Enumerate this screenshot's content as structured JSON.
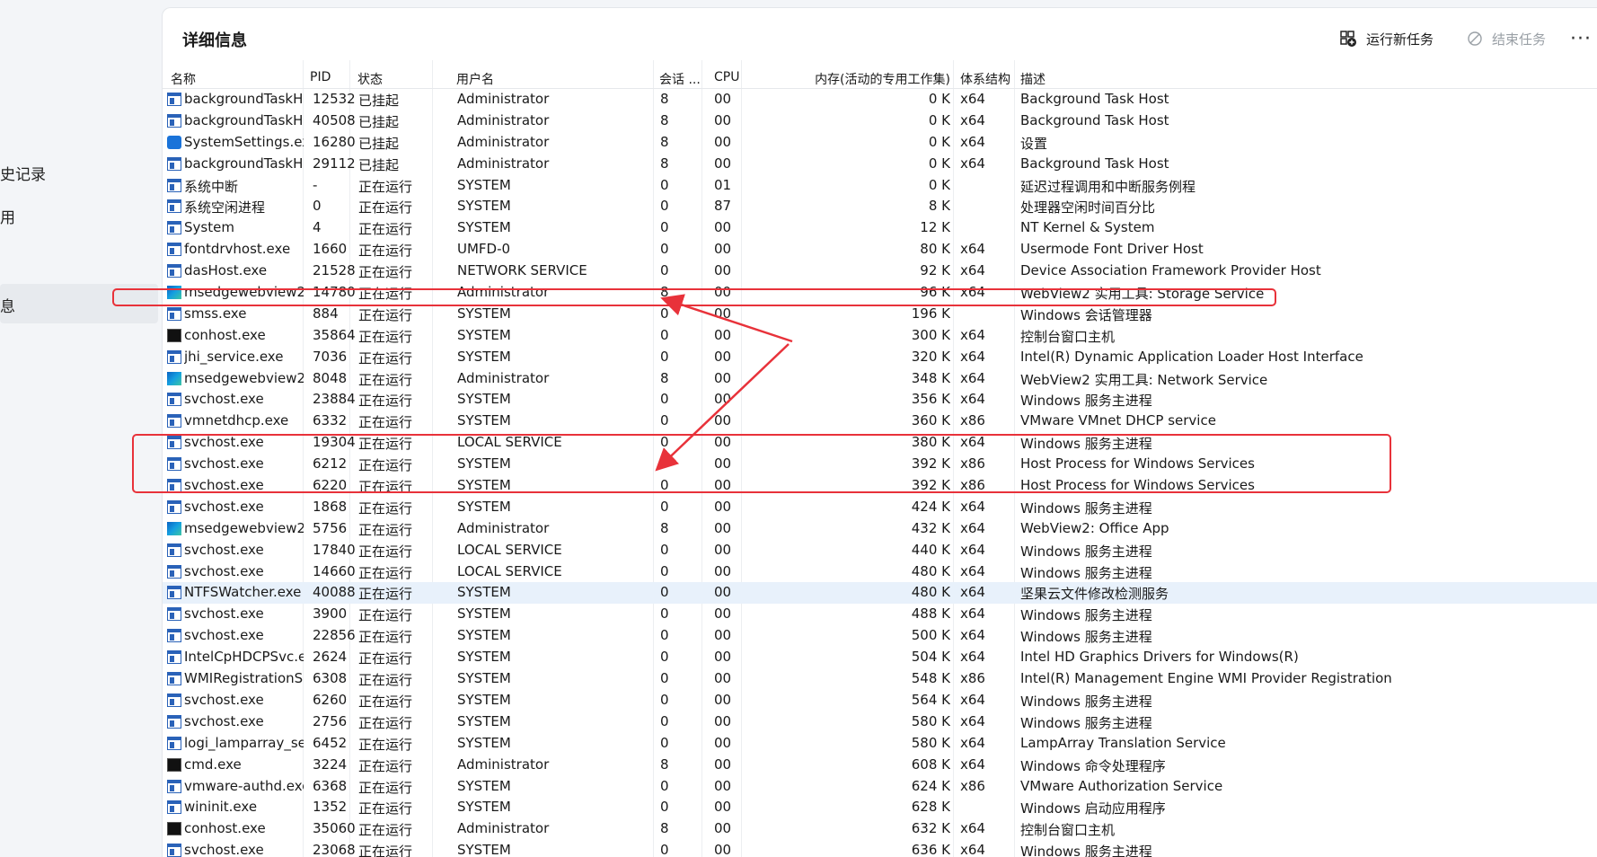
{
  "sidebar": {
    "items": [
      {
        "label": "史记录"
      },
      {
        "label": "用"
      },
      {
        "label": "息"
      }
    ]
  },
  "header": {
    "title": "详细信息",
    "run_new_task": "运行新任务",
    "end_task": "结束任务",
    "more": "···"
  },
  "columns": {
    "name": "名称",
    "pid": "PID",
    "status": "状态",
    "user": "用户名",
    "session": "会话 ...",
    "cpu": "CPU",
    "memory": "内存(活动的专用工作集)",
    "arch": "体系结构",
    "desc": "描述"
  },
  "rows": [
    {
      "icon": "window-icon",
      "name": "backgroundTaskH...",
      "pid": "12532",
      "status": "已挂起",
      "user": "Administrator",
      "session": "8",
      "cpu": "00",
      "mem": "0 K",
      "arch": "x64",
      "desc": "Background Task Host"
    },
    {
      "icon": "window-icon",
      "name": "backgroundTaskH...",
      "pid": "40508",
      "status": "已挂起",
      "user": "Administrator",
      "session": "8",
      "cpu": "00",
      "mem": "0 K",
      "arch": "x64",
      "desc": "Background Task Host"
    },
    {
      "icon": "gear-icon",
      "name": "SystemSettings.exe",
      "pid": "16280",
      "status": "已挂起",
      "user": "Administrator",
      "session": "8",
      "cpu": "00",
      "mem": "0 K",
      "arch": "x64",
      "desc": "设置"
    },
    {
      "icon": "window-icon",
      "name": "backgroundTaskH...",
      "pid": "29112",
      "status": "已挂起",
      "user": "Administrator",
      "session": "8",
      "cpu": "00",
      "mem": "0 K",
      "arch": "x64",
      "desc": "Background Task Host"
    },
    {
      "icon": "window-icon",
      "name": "系统中断",
      "pid": "-",
      "status": "正在运行",
      "user": "SYSTEM",
      "session": "0",
      "cpu": "01",
      "mem": "0 K",
      "arch": "",
      "desc": "延迟过程调用和中断服务例程"
    },
    {
      "icon": "window-icon",
      "name": "系统空闲进程",
      "pid": "0",
      "status": "正在运行",
      "user": "SYSTEM",
      "session": "0",
      "cpu": "87",
      "mem": "8 K",
      "arch": "",
      "desc": "处理器空闲时间百分比"
    },
    {
      "icon": "window-icon",
      "name": "System",
      "pid": "4",
      "status": "正在运行",
      "user": "SYSTEM",
      "session": "0",
      "cpu": "00",
      "mem": "12 K",
      "arch": "",
      "desc": "NT Kernel & System"
    },
    {
      "icon": "window-icon",
      "name": "fontdrvhost.exe",
      "pid": "1660",
      "status": "正在运行",
      "user": "UMFD-0",
      "session": "0",
      "cpu": "00",
      "mem": "80 K",
      "arch": "x64",
      "desc": "Usermode Font Driver Host"
    },
    {
      "icon": "window-icon",
      "name": "dasHost.exe",
      "pid": "21528",
      "status": "正在运行",
      "user": "NETWORK SERVICE",
      "session": "0",
      "cpu": "00",
      "mem": "92 K",
      "arch": "x64",
      "desc": "Device Association Framework Provider Host"
    },
    {
      "icon": "edge-icon",
      "name": "msedgewebview2....",
      "pid": "14780",
      "status": "正在运行",
      "user": "Administrator",
      "session": "8",
      "cpu": "00",
      "mem": "96 K",
      "arch": "x64",
      "desc": "WebView2 实用工具: Storage Service"
    },
    {
      "icon": "window-icon",
      "name": "smss.exe",
      "pid": "884",
      "status": "正在运行",
      "user": "SYSTEM",
      "session": "0",
      "cpu": "00",
      "mem": "196 K",
      "arch": "",
      "desc": "Windows 会话管理器"
    },
    {
      "icon": "terminal-icon",
      "name": "conhost.exe",
      "pid": "35864",
      "status": "正在运行",
      "user": "SYSTEM",
      "session": "0",
      "cpu": "00",
      "mem": "300 K",
      "arch": "x64",
      "desc": "控制台窗口主机"
    },
    {
      "icon": "window-icon",
      "name": "jhi_service.exe",
      "pid": "7036",
      "status": "正在运行",
      "user": "SYSTEM",
      "session": "0",
      "cpu": "00",
      "mem": "320 K",
      "arch": "x64",
      "desc": "Intel(R) Dynamic Application Loader Host Interface"
    },
    {
      "icon": "edge-icon",
      "name": "msedgewebview2....",
      "pid": "8048",
      "status": "正在运行",
      "user": "Administrator",
      "session": "8",
      "cpu": "00",
      "mem": "348 K",
      "arch": "x64",
      "desc": "WebView2 实用工具: Network Service"
    },
    {
      "icon": "window-icon",
      "name": "svchost.exe",
      "pid": "23884",
      "status": "正在运行",
      "user": "SYSTEM",
      "session": "0",
      "cpu": "00",
      "mem": "356 K",
      "arch": "x64",
      "desc": "Windows 服务主进程"
    },
    {
      "icon": "window-icon",
      "name": "vmnetdhcp.exe",
      "pid": "6332",
      "status": "正在运行",
      "user": "SYSTEM",
      "session": "0",
      "cpu": "00",
      "mem": "360 K",
      "arch": "x86",
      "desc": "VMware VMnet DHCP service"
    },
    {
      "icon": "window-icon",
      "name": "svchost.exe",
      "pid": "19304",
      "status": "正在运行",
      "user": "LOCAL SERVICE",
      "session": "0",
      "cpu": "00",
      "mem": "380 K",
      "arch": "x64",
      "desc": "Windows 服务主进程"
    },
    {
      "icon": "window-icon",
      "name": "svchost.exe",
      "pid": "6212",
      "status": "正在运行",
      "user": "SYSTEM",
      "session": "0",
      "cpu": "00",
      "mem": "392 K",
      "arch": "x86",
      "desc": "Host Process for Windows Services"
    },
    {
      "icon": "window-icon",
      "name": "svchost.exe",
      "pid": "6220",
      "status": "正在运行",
      "user": "SYSTEM",
      "session": "0",
      "cpu": "00",
      "mem": "392 K",
      "arch": "x86",
      "desc": "Host Process for Windows Services"
    },
    {
      "icon": "window-icon",
      "name": "svchost.exe",
      "pid": "1868",
      "status": "正在运行",
      "user": "SYSTEM",
      "session": "0",
      "cpu": "00",
      "mem": "424 K",
      "arch": "x64",
      "desc": "Windows 服务主进程"
    },
    {
      "icon": "edge-icon",
      "name": "msedgewebview2....",
      "pid": "5756",
      "status": "正在运行",
      "user": "Administrator",
      "session": "8",
      "cpu": "00",
      "mem": "432 K",
      "arch": "x64",
      "desc": "WebView2: Office App"
    },
    {
      "icon": "window-icon",
      "name": "svchost.exe",
      "pid": "17840",
      "status": "正在运行",
      "user": "LOCAL SERVICE",
      "session": "0",
      "cpu": "00",
      "mem": "440 K",
      "arch": "x64",
      "desc": "Windows 服务主进程"
    },
    {
      "icon": "window-icon",
      "name": "svchost.exe",
      "pid": "14660",
      "status": "正在运行",
      "user": "LOCAL SERVICE",
      "session": "0",
      "cpu": "00",
      "mem": "480 K",
      "arch": "x64",
      "desc": "Windows 服务主进程"
    },
    {
      "icon": "window-icon",
      "name": "NTFSWatcher.exe",
      "pid": "40088",
      "status": "正在运行",
      "user": "SYSTEM",
      "session": "0",
      "cpu": "00",
      "mem": "480 K",
      "arch": "x64",
      "desc": "坚果云文件修改检测服务",
      "selected": true
    },
    {
      "icon": "window-icon",
      "name": "svchost.exe",
      "pid": "3900",
      "status": "正在运行",
      "user": "SYSTEM",
      "session": "0",
      "cpu": "00",
      "mem": "488 K",
      "arch": "x64",
      "desc": "Windows 服务主进程"
    },
    {
      "icon": "window-icon",
      "name": "svchost.exe",
      "pid": "22856",
      "status": "正在运行",
      "user": "SYSTEM",
      "session": "0",
      "cpu": "00",
      "mem": "500 K",
      "arch": "x64",
      "desc": "Windows 服务主进程"
    },
    {
      "icon": "window-icon",
      "name": "IntelCpHDCPSvc.exe",
      "pid": "2624",
      "status": "正在运行",
      "user": "SYSTEM",
      "session": "0",
      "cpu": "00",
      "mem": "504 K",
      "arch": "x64",
      "desc": "Intel HD Graphics Drivers for Windows(R)"
    },
    {
      "icon": "window-icon",
      "name": "WMIRegistrationS...",
      "pid": "6308",
      "status": "正在运行",
      "user": "SYSTEM",
      "session": "0",
      "cpu": "00",
      "mem": "548 K",
      "arch": "x86",
      "desc": "Intel(R) Management Engine WMI Provider Registration"
    },
    {
      "icon": "window-icon",
      "name": "svchost.exe",
      "pid": "6260",
      "status": "正在运行",
      "user": "SYSTEM",
      "session": "0",
      "cpu": "00",
      "mem": "564 K",
      "arch": "x64",
      "desc": "Windows 服务主进程"
    },
    {
      "icon": "window-icon",
      "name": "svchost.exe",
      "pid": "2756",
      "status": "正在运行",
      "user": "SYSTEM",
      "session": "0",
      "cpu": "00",
      "mem": "580 K",
      "arch": "x64",
      "desc": "Windows 服务主进程"
    },
    {
      "icon": "window-icon",
      "name": "logi_lamparray_ser...",
      "pid": "6452",
      "status": "正在运行",
      "user": "SYSTEM",
      "session": "0",
      "cpu": "00",
      "mem": "580 K",
      "arch": "x64",
      "desc": "LampArray Translation Service"
    },
    {
      "icon": "terminal-icon",
      "name": "cmd.exe",
      "pid": "3224",
      "status": "正在运行",
      "user": "Administrator",
      "session": "8",
      "cpu": "00",
      "mem": "608 K",
      "arch": "x64",
      "desc": "Windows 命令处理程序"
    },
    {
      "icon": "window-icon",
      "name": "vmware-authd.exe",
      "pid": "6368",
      "status": "正在运行",
      "user": "SYSTEM",
      "session": "0",
      "cpu": "00",
      "mem": "624 K",
      "arch": "x86",
      "desc": "VMware Authorization Service"
    },
    {
      "icon": "window-icon",
      "name": "wininit.exe",
      "pid": "1352",
      "status": "正在运行",
      "user": "SYSTEM",
      "session": "0",
      "cpu": "00",
      "mem": "628 K",
      "arch": "",
      "desc": "Windows 启动应用程序"
    },
    {
      "icon": "terminal-icon",
      "name": "conhost.exe",
      "pid": "35060",
      "status": "正在运行",
      "user": "Administrator",
      "session": "8",
      "cpu": "00",
      "mem": "632 K",
      "arch": "x64",
      "desc": "控制台窗口主机"
    },
    {
      "icon": "window-icon",
      "name": "svchost.exe",
      "pid": "23068",
      "status": "正在运行",
      "user": "SYSTEM",
      "session": "0",
      "cpu": "00",
      "mem": "636 K",
      "arch": "x64",
      "desc": "Windows 服务主进程"
    }
  ],
  "colors": {
    "highlight": "#e8323a",
    "selected_row": "#e8f1fb"
  }
}
